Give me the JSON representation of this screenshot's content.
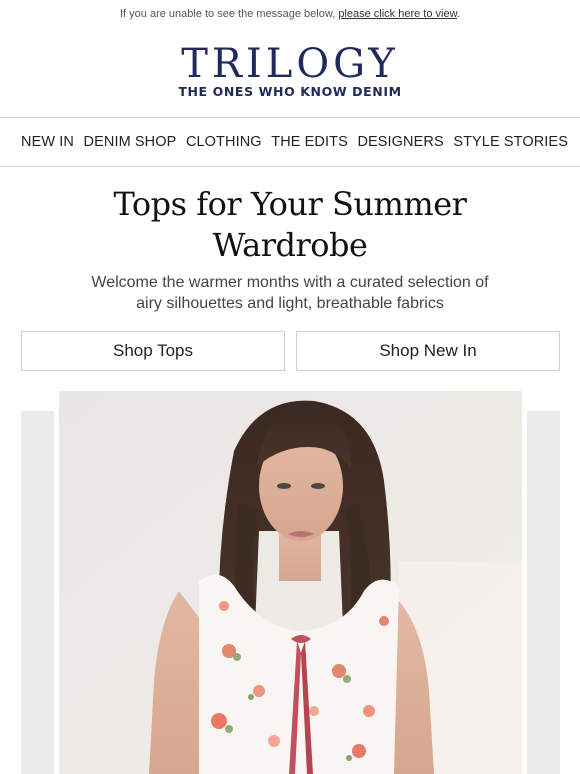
{
  "preheader": {
    "text": "If you are unable to see the message below, ",
    "link": "please click here to view",
    "suffix": "."
  },
  "brand": {
    "logo": "TRILOGY",
    "tagline": "THE ONES WHO KNOW DENIM",
    "color": "#22295c"
  },
  "nav": {
    "items": [
      {
        "label": "NEW IN"
      },
      {
        "label": "DENIM SHOP"
      },
      {
        "label": "CLOTHING"
      },
      {
        "label": "THE EDITS"
      },
      {
        "label": "DESIGNERS"
      },
      {
        "label": "STYLE STORIES"
      }
    ]
  },
  "hero_text": {
    "headline_line1": "Tops for Your Summer",
    "headline_line2": "Wardrobe",
    "subtitle": "Welcome the warmer months with a curated selection of airy silhouettes and light, breathable fabrics"
  },
  "cta": {
    "left": "Shop Tops",
    "right": "Shop New In"
  },
  "hero_image": {
    "subject": "woman in sleeveless floral top with pink tie"
  }
}
